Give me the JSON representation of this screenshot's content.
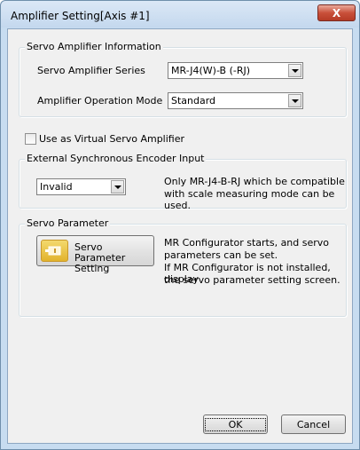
{
  "window": {
    "title": "Amplifier Setting[Axis #1]",
    "close_glyph": "X"
  },
  "servo_info": {
    "group_title": "Servo Amplifier Information",
    "series_label": "Servo Amplifier Series",
    "series_value": "MR-J4(W)-B (-RJ)",
    "mode_label": "Amplifier Operation Mode",
    "mode_value": "Standard"
  },
  "virtual": {
    "label": "Use as Virtual Servo Amplifier",
    "checked": false
  },
  "encoder": {
    "group_title": "External Synchronous Encoder Input",
    "value": "Invalid",
    "note_line1": "Only MR-J4-B-RJ which be compatible",
    "note_line2": "with scale measuring mode can be used."
  },
  "servo_param": {
    "group_title": "Servo Parameter",
    "button_line1": "Servo Parameter",
    "button_line2": "Setting",
    "icon": "servo-parameter-icon",
    "desc_line1": "MR Configurator starts, and servo",
    "desc_line2": "parameters can be set.",
    "desc_line3": "If MR Configurator is not installed, display",
    "desc_line4": "the servo parameter setting screen."
  },
  "footer": {
    "ok_label": "OK",
    "cancel_label": "Cancel"
  },
  "colors": {
    "title_bar": "#c4d8ee",
    "close_button": "#c9503a",
    "dialog_bg": "#f0f0f0"
  }
}
